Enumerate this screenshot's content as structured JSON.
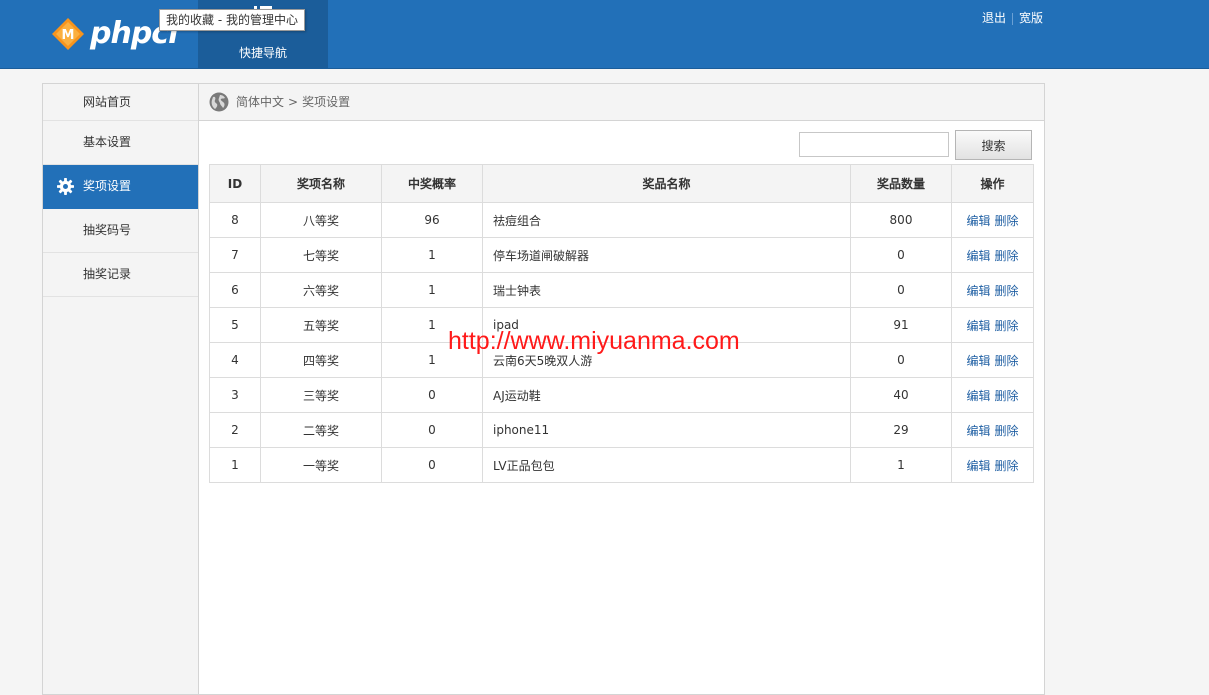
{
  "header": {
    "logo_text": "phpcl",
    "logo_badge": "M",
    "quick_nav_label": "快捷导航",
    "tooltip": "我的收藏 - 我的管理中心",
    "logout": "退出",
    "wide": "宽版"
  },
  "sidebar": {
    "items": [
      {
        "label": "网站首页"
      },
      {
        "label": "基本设置"
      },
      {
        "label": "奖项设置"
      },
      {
        "label": "抽奖码号"
      },
      {
        "label": "抽奖记录"
      }
    ]
  },
  "breadcrumb": {
    "lang": "简体中文",
    "sep": ">",
    "current": "奖项设置"
  },
  "search": {
    "placeholder": "",
    "value": "",
    "button": "搜索"
  },
  "table": {
    "headers": [
      "ID",
      "奖项名称",
      "中奖概率",
      "奖品名称",
      "奖品数量",
      "操作"
    ],
    "edit_label": "编辑",
    "delete_label": "删除",
    "rows": [
      {
        "id": "8",
        "award": "八等奖",
        "prob": "96",
        "prize": "祛痘组合",
        "qty": "800"
      },
      {
        "id": "7",
        "award": "七等奖",
        "prob": "1",
        "prize": "停车场道闸破解器",
        "qty": "0"
      },
      {
        "id": "6",
        "award": "六等奖",
        "prob": "1",
        "prize": "瑞士钟表",
        "qty": "0"
      },
      {
        "id": "5",
        "award": "五等奖",
        "prob": "1",
        "prize": "ipad",
        "qty": "91"
      },
      {
        "id": "4",
        "award": "四等奖",
        "prob": "1",
        "prize": "云南6天5晚双人游",
        "qty": "0"
      },
      {
        "id": "3",
        "award": "三等奖",
        "prob": "0",
        "prize": "AJ运动鞋",
        "qty": "40"
      },
      {
        "id": "2",
        "award": "二等奖",
        "prob": "0",
        "prize": "iphone11",
        "qty": "29"
      },
      {
        "id": "1",
        "award": "一等奖",
        "prob": "0",
        "prize": "LV正品包包",
        "qty": "1"
      }
    ]
  },
  "watermark": "http://www.miyuanma.com",
  "colors": {
    "brand_blue": "#2270b8",
    "brand_blue_dark": "#1b5d9a",
    "logo_orange": "#f7941d",
    "link_blue": "#1f5fa3",
    "watermark_red": "#ff1a1a"
  }
}
